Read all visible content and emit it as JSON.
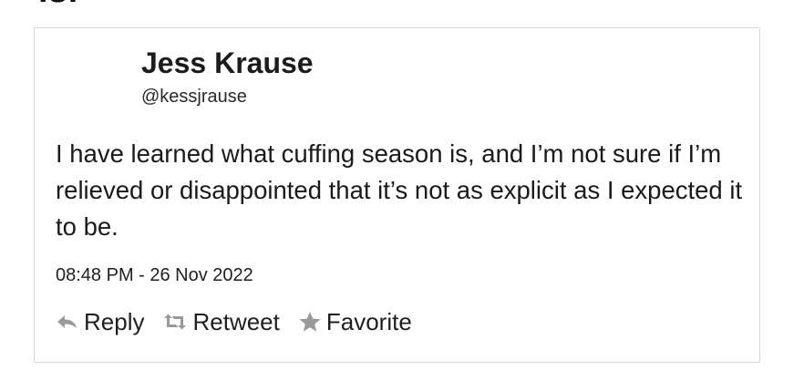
{
  "page": {
    "cut_heading": "is."
  },
  "tweet": {
    "author_name": "Jess Krause",
    "author_handle": "@kessjrause",
    "text": "I have learned what cuffing season is, and I’m not sure if I’m relieved or disappointed that it’s not as explicit as I expected it to be.",
    "timestamp": "08:48 PM - 26 Nov 2022"
  },
  "actions": {
    "reply_label": "Reply",
    "reply_icon": "reply-arrow-icon",
    "retweet_label": "Retweet",
    "retweet_icon": "retweet-icon",
    "favorite_label": "Favorite",
    "favorite_icon": "star-icon"
  },
  "colors": {
    "text": "#1a1a1a",
    "icon_gray": "#9a9a9a",
    "border": "#d6d6d6",
    "background": "#ffffff"
  }
}
